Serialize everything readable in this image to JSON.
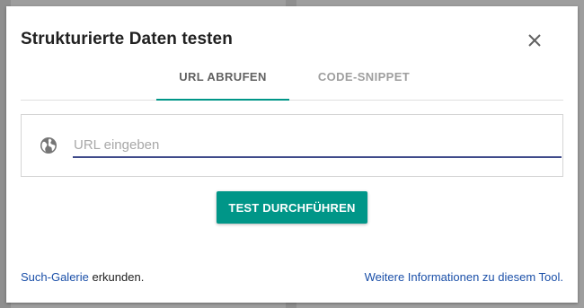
{
  "dialog": {
    "title": "Strukturierte Daten testen",
    "close_icon": "close-icon"
  },
  "tabs": [
    {
      "label": "URL ABRUFEN",
      "active": true
    },
    {
      "label": "CODE-SNIPPET",
      "active": false
    }
  ],
  "url_input": {
    "icon": "globe-icon",
    "placeholder": "URL eingeben",
    "value": ""
  },
  "run_button": {
    "label": "TEST DURCHFÜHREN"
  },
  "footer": {
    "gallery_link": "Such-Galerie",
    "gallery_suffix": " erkunden.",
    "info_link": "Weitere Informationen zu diesem Tool."
  },
  "colors": {
    "accent": "#009688",
    "link": "#1a4fa8",
    "input_underline": "#3f4a8a"
  }
}
